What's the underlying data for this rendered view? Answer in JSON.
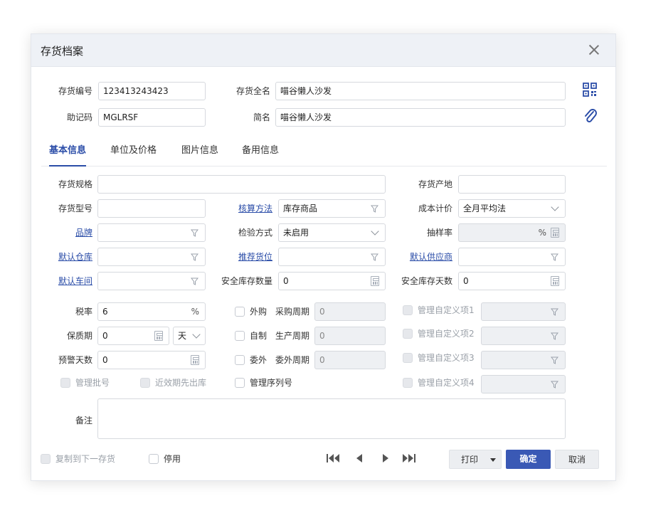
{
  "dialog": {
    "title": "存货档案"
  },
  "header": {
    "code_label": "存货编号",
    "code_value": "123413243423",
    "fullname_label": "存货全名",
    "fullname_value": "喵谷懒人沙发",
    "mnemonic_label": "助记码",
    "mnemonic_value": "MGLRSF",
    "shortname_label": "简名",
    "shortname_value": "喵谷懒人沙发"
  },
  "tabs": [
    "基本信息",
    "单位及价格",
    "图片信息",
    "备用信息"
  ],
  "basic": {
    "spec_label": "存货规格",
    "origin_label": "存货产地",
    "model_label": "存货型号",
    "accounting_label": "核算方法",
    "accounting_value": "库存商品",
    "costing_label": "成本计价",
    "costing_value": "全月平均法",
    "brand_label": "品牌",
    "inspection_label": "检验方式",
    "inspection_value": "未启用",
    "sampling_label": "抽样率",
    "sampling_unit": "%",
    "warehouse_label": "默认仓库",
    "location_label": "推荐货位",
    "supplier_label": "默认供应商",
    "workshop_label": "默认车间",
    "safety_qty_label": "安全库存数量",
    "safety_qty_value": "0",
    "safety_days_label": "安全库存天数",
    "safety_days_value": "0",
    "tax_label": "税率",
    "tax_value": "6",
    "tax_unit": "%",
    "outsource_label": "外购",
    "purchase_cycle_label": "采购周期",
    "purchase_cycle_value": "0",
    "custom1_label": "管理自定义项1",
    "shelf_label": "保质期",
    "shelf_value": "0",
    "shelf_unit": "天",
    "selfmade_label": "自制",
    "production_cycle_label": "生产周期",
    "production_cycle_value": "0",
    "custom2_label": "管理自定义项2",
    "warn_label": "预警天数",
    "warn_value": "0",
    "subcontract_label": "委外",
    "subcontract_cycle_label": "委外周期",
    "subcontract_cycle_value": "0",
    "custom3_label": "管理自定义项3",
    "batch_label": "管理批号",
    "fefo_label": "近效期先出库",
    "serial_label": "管理序列号",
    "custom4_label": "管理自定义项4",
    "remark_label": "备注"
  },
  "footer": {
    "copy_label": "复制到下一存货",
    "disable_label": "停用",
    "print_label": "打印",
    "ok_label": "确定",
    "cancel_label": "取消"
  }
}
